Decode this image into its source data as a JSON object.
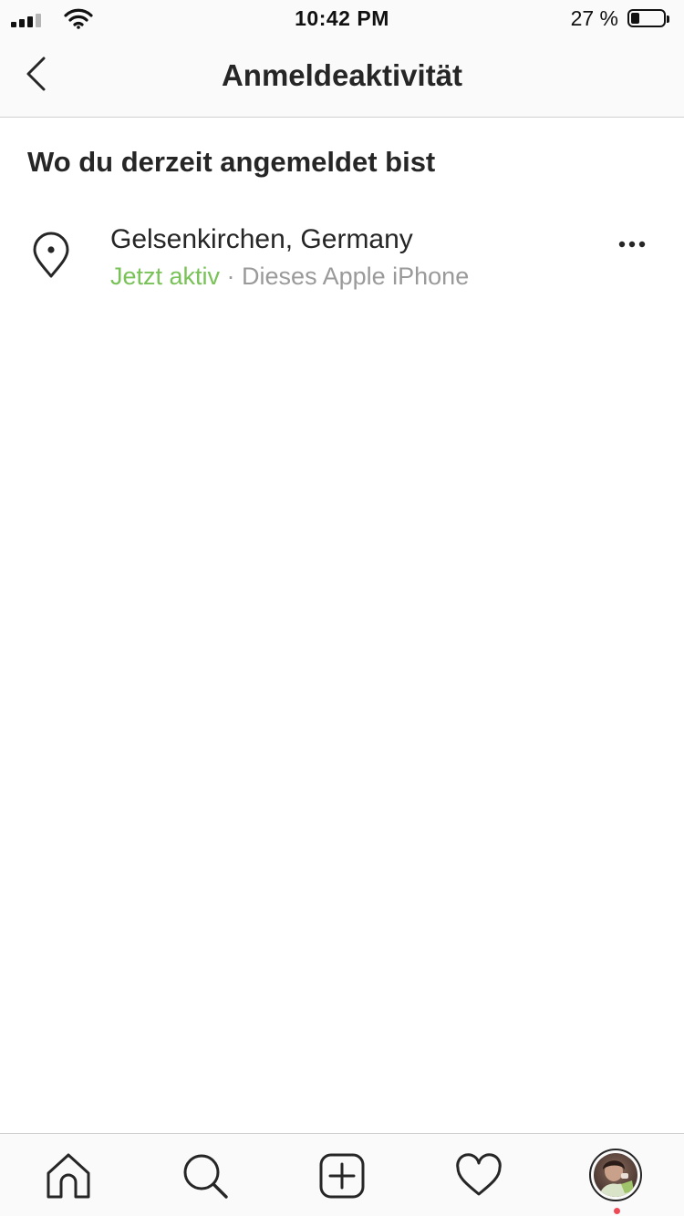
{
  "status_bar": {
    "time": "10:42 PM",
    "battery_text": "27 %",
    "battery_level": 0.27
  },
  "header": {
    "title": "Anmeldeaktivität"
  },
  "section": {
    "title": "Wo du derzeit angemeldet bist"
  },
  "sessions": [
    {
      "location": "Gelsenkirchen, Germany",
      "status": "Jetzt aktiv",
      "separator": " · ",
      "device": "Dieses Apple iPhone"
    }
  ],
  "icons": {
    "back": "chevron-left-icon",
    "location": "map-pin-icon",
    "more": "ellipsis-icon",
    "home": "home-icon",
    "search": "search-icon",
    "create": "plus-square-icon",
    "likes": "heart-icon",
    "profile": "avatar"
  },
  "colors": {
    "active_status": "#78c257",
    "secondary_text": "#9a9a9a",
    "notification": "#ed4956"
  }
}
